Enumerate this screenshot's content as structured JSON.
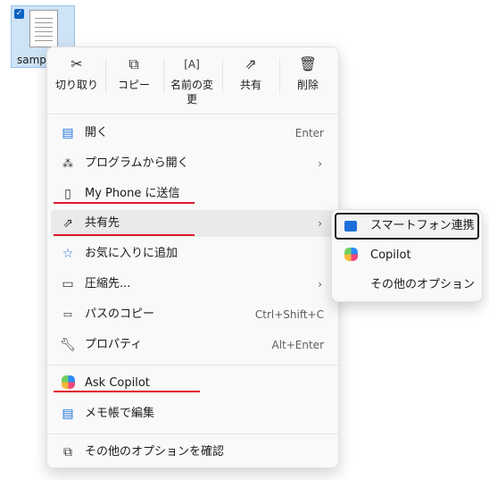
{
  "desktop": {
    "file_name": "samp"
  },
  "toolbar": {
    "cut": "切り取り",
    "copy": "コピー",
    "rename": "名前の変\n更",
    "share": "共有",
    "delete": "削除"
  },
  "menu": {
    "open": "開く",
    "open_shortcut": "Enter",
    "open_with": "プログラムから開く",
    "send_to_phone": "My Phone に送信",
    "share_to": "共有先",
    "add_favorites": "お気に入りに追加",
    "compress": "圧縮先...",
    "copy_path": "パスのコピー",
    "copy_path_shortcut": "Ctrl+Shift+C",
    "properties": "プロパティ",
    "properties_shortcut": "Alt+Enter",
    "ask_copilot": "Ask Copilot",
    "edit_notepad": "メモ帳で編集",
    "more_options": "その他のオプションを確認"
  },
  "submenu": {
    "phone_link": "スマートフォン連携",
    "copilot": "Copilot",
    "other_options": "その他のオプション"
  },
  "colors": {
    "annotation_underline": "#e0182d",
    "accent": "#0b63c5"
  }
}
